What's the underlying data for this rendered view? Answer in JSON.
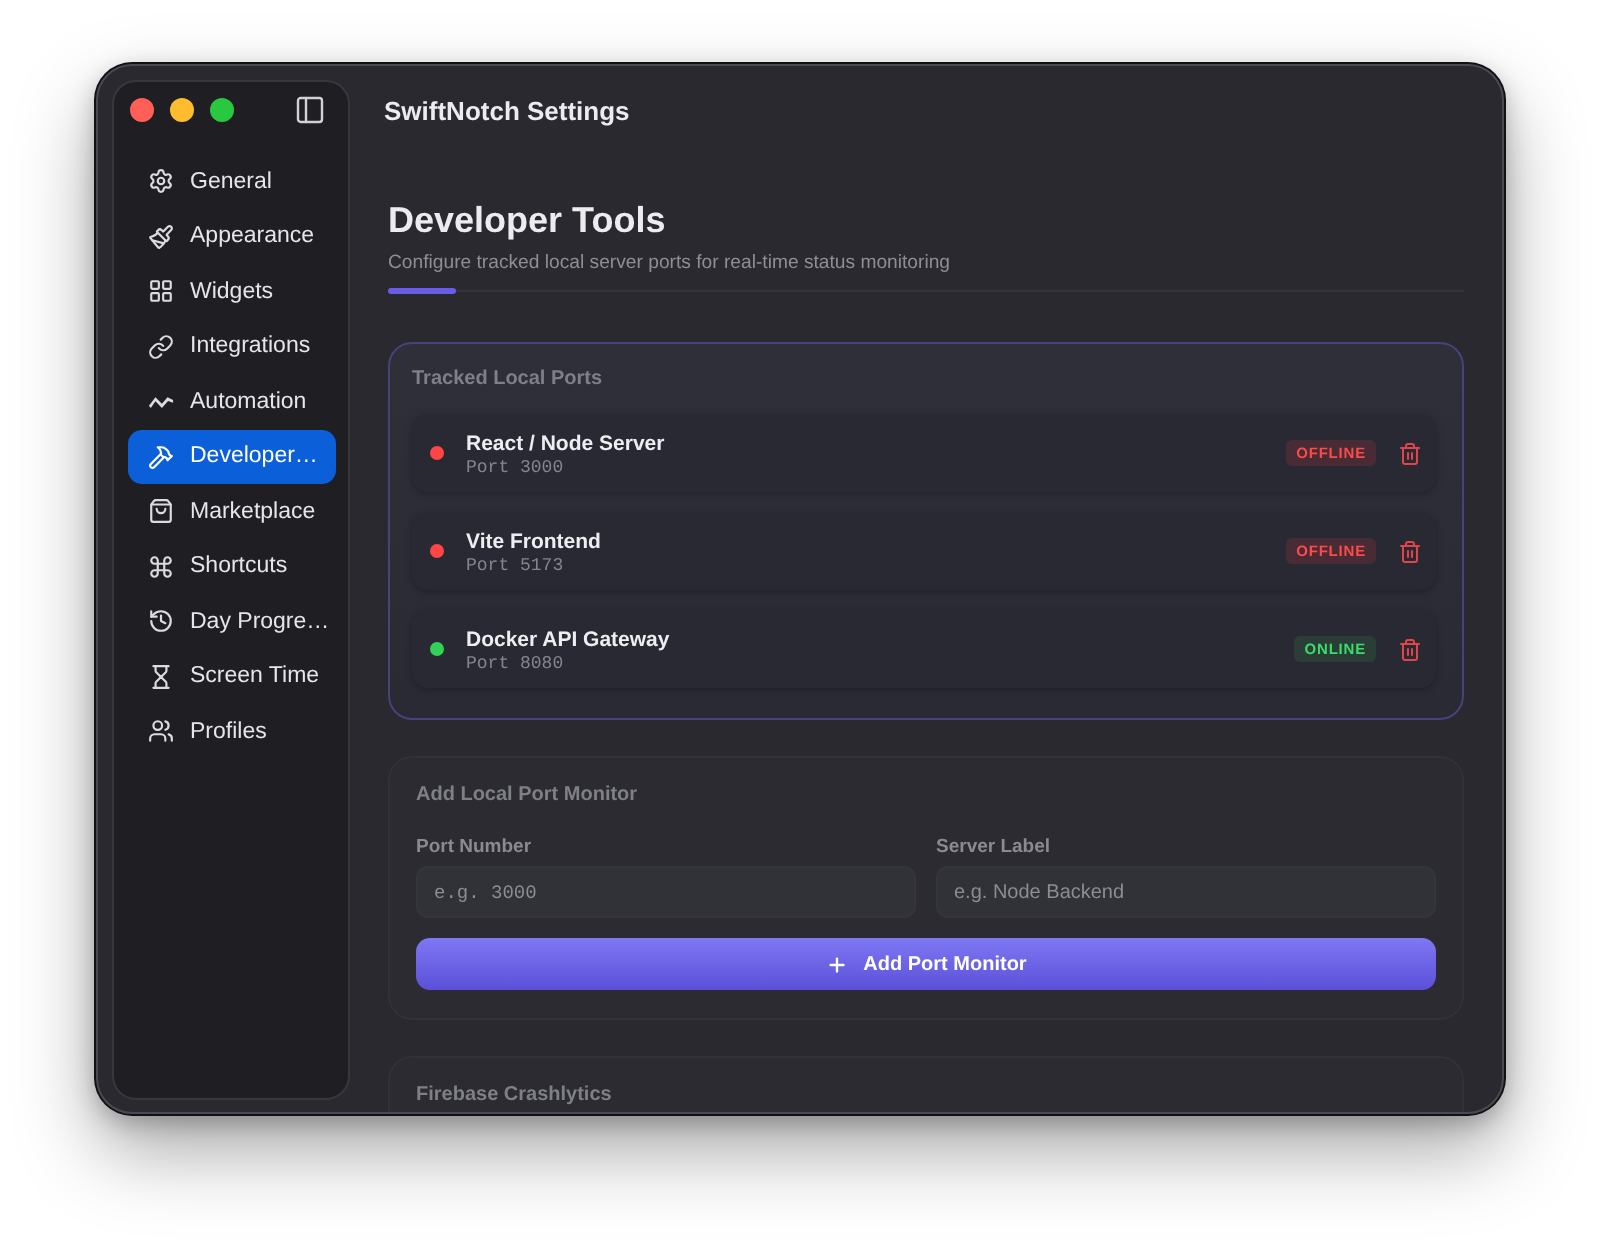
{
  "window": {
    "title": "SwiftNotch Settings"
  },
  "sidebar": {
    "items": [
      {
        "label": "General",
        "selected": false
      },
      {
        "label": "Appearance",
        "selected": false
      },
      {
        "label": "Widgets",
        "selected": false
      },
      {
        "label": "Integrations",
        "selected": false
      },
      {
        "label": "Automation",
        "selected": false
      },
      {
        "label": "Developer…",
        "selected": true
      },
      {
        "label": "Marketplace",
        "selected": false
      },
      {
        "label": "Shortcuts",
        "selected": false
      },
      {
        "label": "Day Progre…",
        "selected": false
      },
      {
        "label": "Screen Time",
        "selected": false
      },
      {
        "label": "Profiles",
        "selected": false
      }
    ]
  },
  "header": {
    "title": "Developer Tools",
    "subtitle": "Configure tracked local server ports for real-time status monitoring"
  },
  "tracked_ports": {
    "title": "Tracked Local Ports",
    "ports": [
      {
        "name": "React / Node Server",
        "port": "Port 3000",
        "status": "OFFLINE",
        "online": false
      },
      {
        "name": "Vite Frontend",
        "port": "Port 5173",
        "status": "OFFLINE",
        "online": false
      },
      {
        "name": "Docker API Gateway",
        "port": "Port 8080",
        "status": "ONLINE",
        "online": true
      }
    ]
  },
  "add_monitor": {
    "title": "Add Local Port Monitor",
    "fields": [
      {
        "label": "Port Number",
        "placeholder": "e.g. 3000",
        "kind": "number"
      },
      {
        "label": "Server Label",
        "placeholder": "e.g. Node Backend",
        "kind": "text"
      }
    ],
    "button": "Add Port Monitor"
  },
  "crashlytics": {
    "title": "Firebase Crashlytics"
  }
}
